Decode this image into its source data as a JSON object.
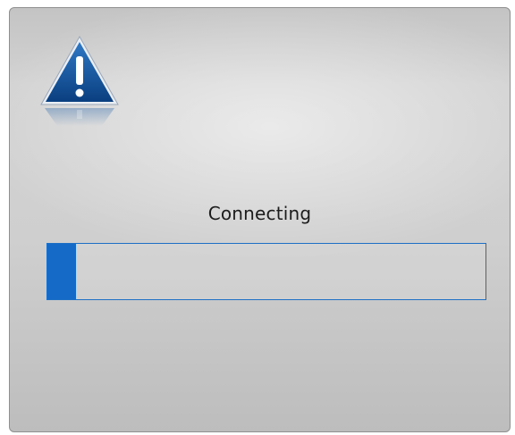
{
  "status": {
    "text": "Connecting"
  },
  "progress": {
    "fraction": 0.065,
    "fill_color": "#1569c7",
    "border_color": "#1c6fc4"
  },
  "icon": {
    "name": "warning-icon"
  }
}
